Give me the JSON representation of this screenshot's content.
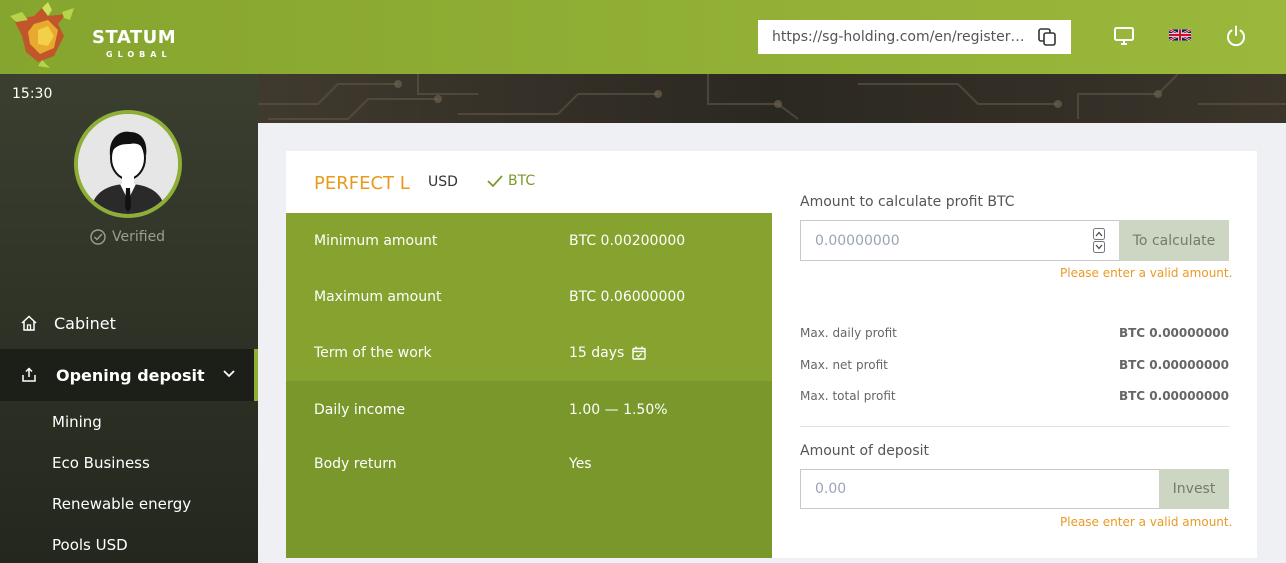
{
  "header": {
    "logo_text": "STATUM",
    "logo_sub": "GLOBAL",
    "referral_link": "https://sg-holding.com/en/register/...",
    "icons": [
      "copy-icon",
      "monitor-icon",
      "uk-flag-icon",
      "power-icon"
    ]
  },
  "sidebar": {
    "time": "15:30",
    "status": "Verified",
    "nav": [
      {
        "label": "Cabinet",
        "icon": "home-icon"
      },
      {
        "label": "Opening deposit",
        "icon": "upload-icon"
      }
    ],
    "sub_items": [
      "Mining",
      "Eco Business",
      "Renewable energy",
      "Pools USD"
    ]
  },
  "plan": {
    "title": "PERFECT L",
    "currencies": [
      "USD",
      "BTC"
    ],
    "selected_currency": "BTC",
    "rows": [
      {
        "label": "Minimum amount",
        "value": "BTC 0.00200000"
      },
      {
        "label": "Maximum amount",
        "value": "BTC 0.06000000"
      },
      {
        "label": "Term of the work",
        "value": "15 days"
      },
      {
        "label": "Daily income",
        "value": "1.00 — 1.50%"
      },
      {
        "label": "Body return",
        "value": "Yes"
      }
    ]
  },
  "calculator": {
    "label": "Amount to calculate profit BTC",
    "placeholder": "0.00000000",
    "button": "To calculate",
    "error": "Please enter a valid amount.",
    "stats": [
      {
        "label": "Max. daily profit",
        "value": "BTC 0.00000000"
      },
      {
        "label": "Max. net profit",
        "value": "BTC 0.00000000"
      },
      {
        "label": "Max. total profit",
        "value": "BTC 0.00000000"
      }
    ]
  },
  "deposit": {
    "label": "Amount of deposit",
    "placeholder": "0.00",
    "button": "Invest",
    "error": "Please enter a valid amount."
  },
  "colors": {
    "accent": "#8fae35",
    "orange": "#e79a1c",
    "sidebar": "#2e3326"
  }
}
